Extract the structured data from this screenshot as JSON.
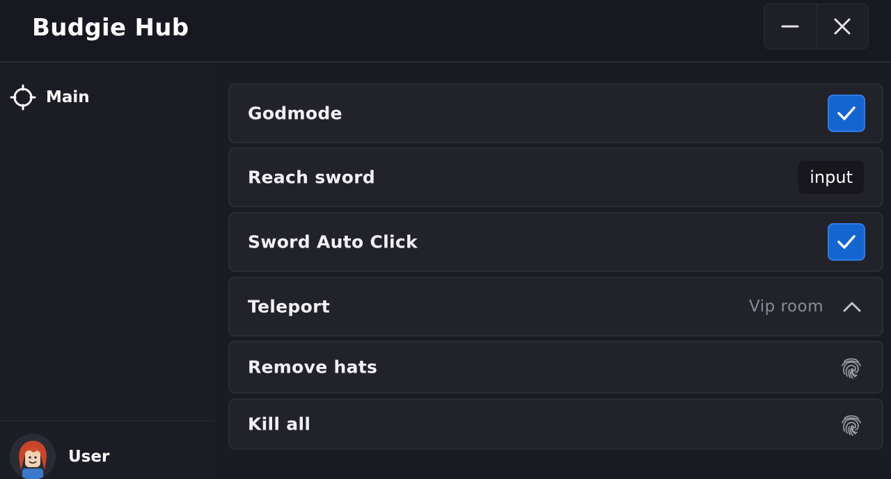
{
  "window": {
    "title": "Budgie Hub",
    "controls": {
      "minimize_icon": "minus-icon",
      "close_icon": "close-icon"
    }
  },
  "sidebar": {
    "items": [
      {
        "label": "Main",
        "icon": "crosshair-icon"
      }
    ],
    "user": {
      "label": "User",
      "avatar": "avatar-icon"
    }
  },
  "main": {
    "rows": [
      {
        "label": "Godmode",
        "control": "checkbox",
        "checked": true
      },
      {
        "label": "Reach sword",
        "control": "input",
        "value": "input"
      },
      {
        "label": "Sword Auto Click",
        "control": "checkbox",
        "checked": true
      },
      {
        "label": "Teleport",
        "control": "dropdown",
        "value": "Vip room"
      },
      {
        "label": "Remove hats",
        "control": "button",
        "icon": "fingerprint-icon"
      },
      {
        "label": "Kill all",
        "control": "button",
        "icon": "fingerprint-icon"
      }
    ]
  },
  "colors": {
    "background": "#1b1b22",
    "titlebar": "#181820",
    "row": "#22222b",
    "accent": "#1565d1",
    "muted_text": "#8c8c96"
  }
}
